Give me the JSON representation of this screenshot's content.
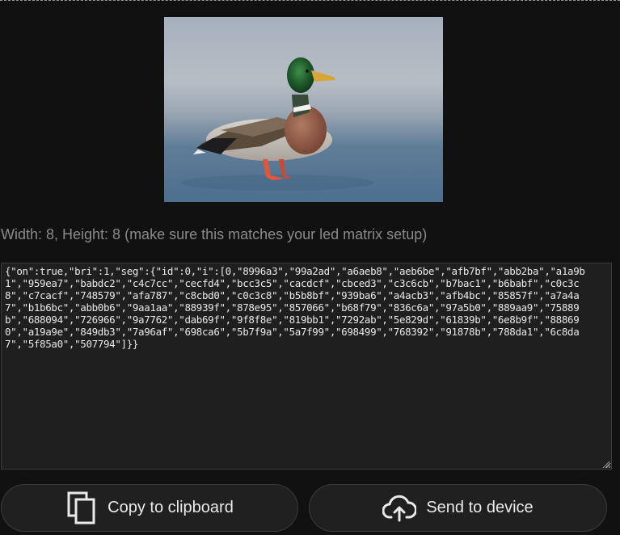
{
  "preview": {
    "alt": "mallard duck standing on ice"
  },
  "matrix_info": "Width: 8, Height: 8 (make sure this matches your led matrix setup)",
  "json_output": "{\"on\":true,\"bri\":1,\"seg\":{\"id\":0,\"i\":[0,\"8996a3\",\"99a2ad\",\"a6aeb8\",\"aeb6be\",\"afb7bf\",\"abb2ba\",\"a1a9b1\",\"959ea7\",\"babdc2\",\"c4c7cc\",\"cecfd4\",\"bcc3c5\",\"cacdcf\",\"cbced3\",\"c3c6cb\",\"b7bac1\",\"b6babf\",\"c0c3c8\",\"c7cacf\",\"748579\",\"afa787\",\"c8cbd0\",\"c0c3c8\",\"b5b8bf\",\"939ba6\",\"a4acb3\",\"afb4bc\",\"85857f\",\"a7a4a7\",\"b1b6bc\",\"abb0b6\",\"9aa1aa\",\"88939f\",\"878e95\",\"857066\",\"b68f79\",\"836c6a\",\"97a5b0\",\"889aa9\",\"75889b\",\"688094\",\"726966\",\"9a7762\",\"dab69f\",\"9f8f8e\",\"819bb1\",\"7292ab\",\"5e829d\",\"61839b\",\"6e8b9f\",\"888690\",\"a19a9e\",\"849db3\",\"7a96af\",\"698ca6\",\"5b7f9a\",\"5a7f99\",\"698499\",\"768392\",\"91878b\",\"788da1\",\"6c8da7\",\"5f85a0\",\"507794\"]}}",
  "buttons": {
    "copy_label": "Copy to clipboard",
    "send_label": "Send to device"
  },
  "icons": {
    "copy": "copy-icon",
    "send": "cloud-upload-icon"
  }
}
